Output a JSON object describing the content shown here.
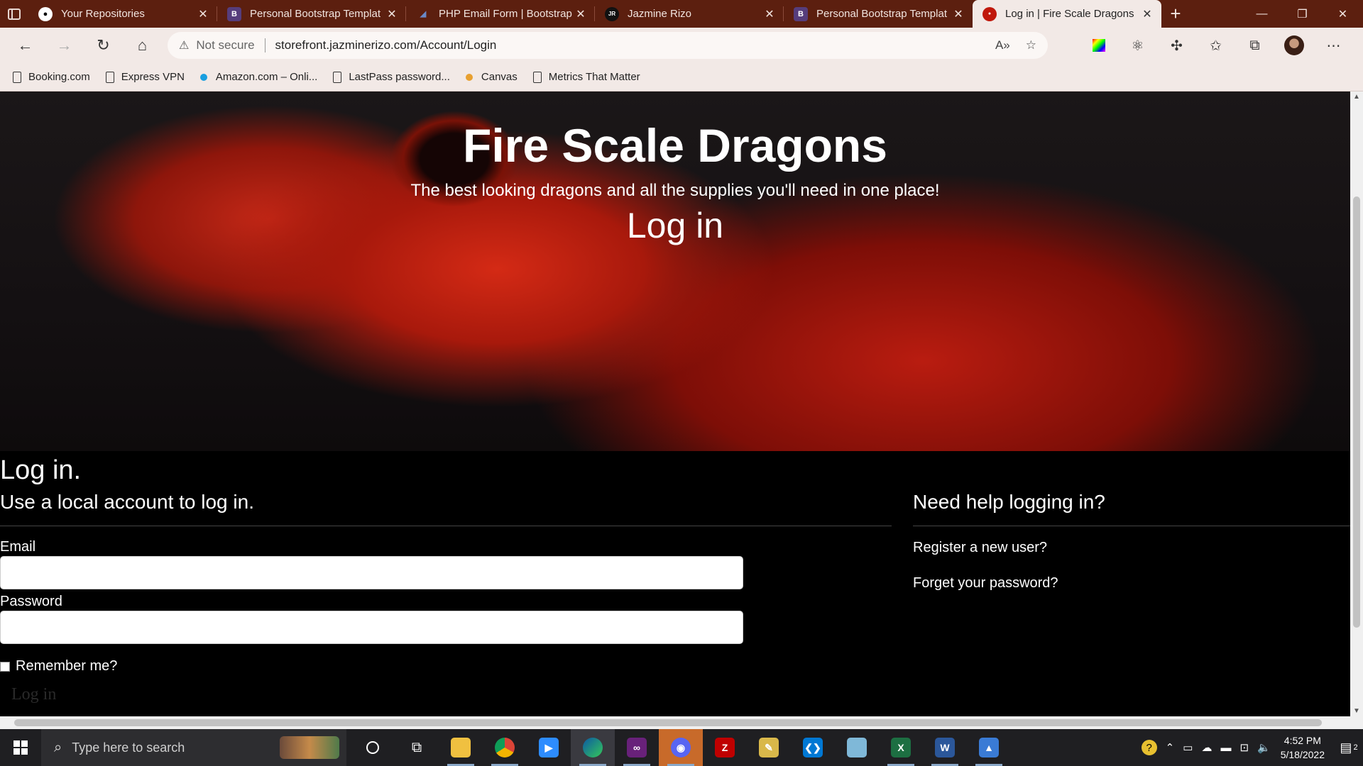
{
  "browser": {
    "tabs": [
      {
        "title": "Your Repositories",
        "favicon": "github-icon",
        "active": false
      },
      {
        "title": "Personal Bootstrap Templat",
        "favicon": "bootstrap-icon",
        "active": false
      },
      {
        "title": "PHP Email Form | Bootstrap",
        "favicon": "bootstrapmade-icon",
        "active": false
      },
      {
        "title": "Jazmine Rizo",
        "favicon": "jr-icon",
        "active": false
      },
      {
        "title": "Personal Bootstrap Templat",
        "favicon": "bootstrap-icon",
        "active": false
      },
      {
        "title": "Log in | Fire Scale Dragons",
        "favicon": "fsd-icon",
        "active": true
      }
    ],
    "address": {
      "security_text": "Not secure",
      "url": "storefront.jazminerizo.com/Account/Login"
    },
    "favorites": [
      {
        "label": "Booking.com",
        "icon": "page-icon"
      },
      {
        "label": "Express VPN",
        "icon": "page-icon"
      },
      {
        "label": "Amazon.com – Onli...",
        "icon": "dot-icon"
      },
      {
        "label": "LastPass password...",
        "icon": "page-icon"
      },
      {
        "label": "Canvas",
        "icon": "dot-icon"
      },
      {
        "label": "Metrics That Matter",
        "icon": "page-icon"
      }
    ]
  },
  "hero": {
    "title": "Fire Scale Dragons",
    "subtitle": "The best looking dragons and all the supplies you'll need in one place!",
    "heading": "Log in"
  },
  "login": {
    "page_title": "Log in.",
    "subtitle": "Use a local account to log in.",
    "email_label": "Email",
    "email_value": "",
    "password_label": "Password",
    "password_value": "",
    "remember_label": "Remember me?",
    "remember_checked": false,
    "submit_label": "Log in"
  },
  "help": {
    "title": "Need help logging in?",
    "register_link": "Register a new user?",
    "forgot_link": "Forget your password?"
  },
  "taskbar": {
    "search_placeholder": "Type here to search",
    "time": "4:52 PM",
    "date": "5/18/2022",
    "notification_count": "2"
  },
  "colors": {
    "tab_strip": "#5c1f0f",
    "toolbar": "#f2e9e6",
    "page_bg": "#000000",
    "hero_red": "#c42817"
  }
}
